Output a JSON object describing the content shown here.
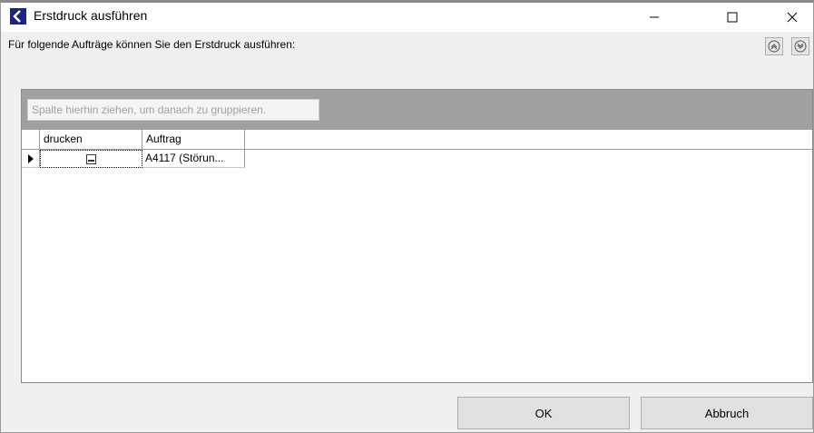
{
  "window": {
    "title": "Erstdruck ausführen"
  },
  "header": {
    "text": "Für folgende Aufträge können Sie den Erstdruck ausführen:"
  },
  "grid": {
    "group_placeholder": "Spalte hierhin ziehen, um danach zu gruppieren.",
    "columns": [
      "drucken",
      "Auftrag"
    ],
    "rows": [
      {
        "drucken": false,
        "auftrag": "A4117 (Störun..."
      }
    ]
  },
  "buttons": {
    "ok": "OK",
    "cancel": "Abbruch"
  },
  "icons": {
    "app": "back-arrow-icon",
    "expand_all": "expand-all-icon",
    "collapse_all": "collapse-all-icon"
  }
}
